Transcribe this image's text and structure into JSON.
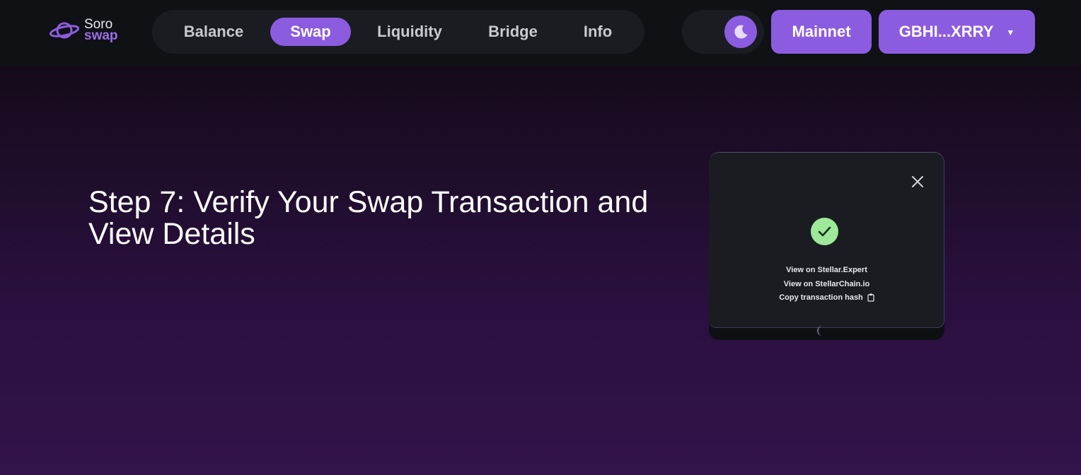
{
  "header": {
    "logo": {
      "line1": "Soro",
      "line2": "swap"
    },
    "nav": [
      {
        "label": "Balance",
        "active": false
      },
      {
        "label": "Swap",
        "active": true
      },
      {
        "label": "Liquidity",
        "active": false
      },
      {
        "label": "Bridge",
        "active": false
      },
      {
        "label": "Info",
        "active": false
      }
    ],
    "theme_icon": "moon-icon",
    "network_label": "Mainnet",
    "wallet_label": "GBHI...XRRY",
    "wallet_caret_icon": "caret-down-icon"
  },
  "main": {
    "heading": "Step 7: Verify Your Swap Transaction and View Details",
    "screenshot": {
      "close_icon": "close-icon",
      "status_icon": "check-icon",
      "links": [
        "View on Stellar.Expert",
        "View on StellarChain.io",
        "Copy transaction hash"
      ],
      "copy_icon": "clipboard-icon"
    }
  },
  "colors": {
    "accent": "#8c5ce0",
    "header_bg": "#0f1114",
    "pill_bg": "#1a1c22",
    "success": "#9ee89a"
  }
}
